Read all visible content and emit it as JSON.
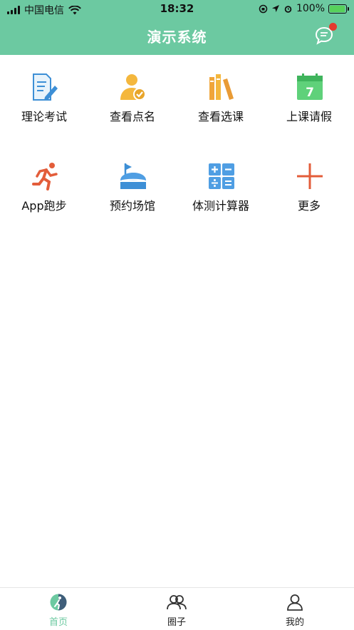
{
  "status_bar": {
    "carrier": "中国电信",
    "time": "18:32",
    "battery": "100%",
    "battery_level": 1.0
  },
  "header": {
    "title": "演示系统",
    "accent": "#6cc9a1",
    "badge_color": "#e33b2e"
  },
  "grid": {
    "items": [
      {
        "label": "理论考试",
        "icon": "exam-document-icon"
      },
      {
        "label": "查看点名",
        "icon": "user-check-icon"
      },
      {
        "label": "查看选课",
        "icon": "books-icon"
      },
      {
        "label": "上课请假",
        "icon": "calendar-icon",
        "icon_text": "7"
      },
      {
        "label": "App跑步",
        "icon": "runner-icon"
      },
      {
        "label": "预约场馆",
        "icon": "stadium-flag-icon"
      },
      {
        "label": "体测计算器",
        "icon": "calculator-icon"
      },
      {
        "label": "更多",
        "icon": "plus-icon"
      }
    ]
  },
  "tabbar": {
    "tabs": [
      {
        "label": "首页",
        "icon": "home-runner-icon",
        "active": true
      },
      {
        "label": "圈子",
        "icon": "group-icon",
        "active": false
      },
      {
        "label": "我的",
        "icon": "person-icon",
        "active": false
      }
    ]
  }
}
